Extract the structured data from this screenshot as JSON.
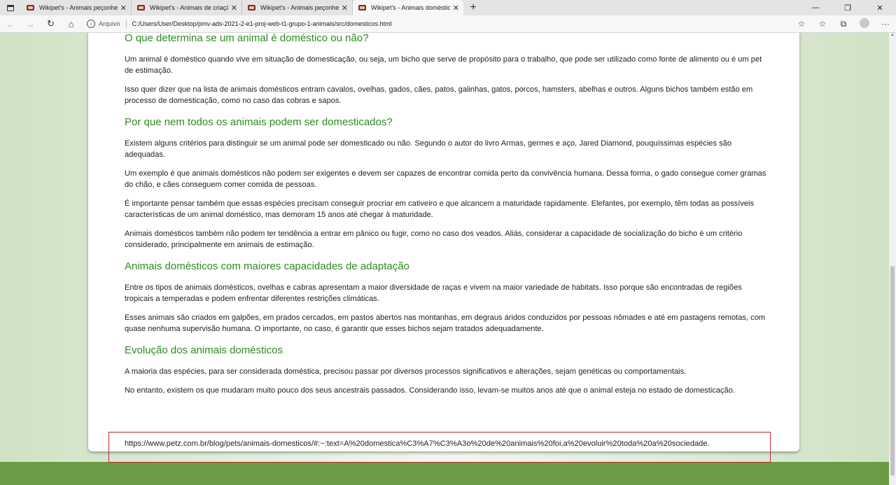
{
  "browser": {
    "tabs": [
      {
        "title": "Wikipet's - Animais peçonhentos",
        "close": "✕"
      },
      {
        "title": "Wikipet's - Animais de criação",
        "close": "✕"
      },
      {
        "title": "Wikipet's - Animais peçonhentos",
        "close": "✕"
      },
      {
        "title": "Wikipet's - Animais domésticos",
        "close": "✕"
      }
    ],
    "active_tab_index": 3,
    "new_tab": "+",
    "window_controls": {
      "minimize": "—",
      "restore": "❐",
      "close": "✕"
    },
    "nav": {
      "back": "←",
      "forward": "→",
      "refresh": "↻",
      "home": "⌂"
    },
    "address": {
      "info_icon": "i",
      "scheme_label": "Arquivo",
      "url": "C:/Users/User/Desktop/pmv-ads-2021-2-e1-proj-web-t1-grupo-1-animais/src/domesticos.html"
    },
    "toolbar_icons": {
      "favorite_add": "☆",
      "favorites": "☆",
      "collections": "⧉",
      "more": "···"
    }
  },
  "page": {
    "heading1": "O que determina se um animal é doméstico ou não?",
    "p1": "Um animal é doméstico quando vive em situação de domesticação, ou seja, um bicho que serve de propósito para o trabalho, que pode ser utilizado como fonte de alimento ou é um pet de estimação.",
    "p2": "Isso quer dizer que na lista de animais domésticos entram cavalos, ovelhas, gados, cães, patos, galinhas, gatos, porcos, hamsters, abelhas e outros. Alguns bichos também estão em processo de domesticação, como no caso das cobras e sapos.",
    "heading2": "Por que nem todos os animais podem ser domesticados?",
    "p3": "Existem alguns critérios para distinguir se um animal pode ser domesticado ou não. Segundo o autor do livro Armas, germes e aço, Jared Diamond, pouquíssimas espécies são adequadas.",
    "p4": "Um exemplo é que animais domésticos não podem ser exigentes e devem ser capazes de encontrar comida perto da convivência humana. Dessa forma, o gado consegue comer gramas do chão, e cães conseguem comer comida de pessoas.",
    "p5": "É importante pensar também que essas espécies precisam conseguir procriar em cativeiro e que alcancem a maturidade rapidamente. Elefantes, por exemplo, têm todas as possíveis características de um animal doméstico, mas demoram 15 anos até chegar à maturidade.",
    "p6": "Animais domésticos também não podem ter tendência a entrar em pânico ou fugir, como no caso dos veados. Aliás, considerar a capacidade de socialização do bicho é um critério considerado, principalmente em animais de estimação.",
    "heading3": "Animais domésticos com maiores capacidades de adaptação",
    "p7": "Entre os tipos de animais domésticos, ovelhas e cabras apresentam a maior diversidade de raças e vivem na maior variedade de habitats. Isso porque são encontradas de regiões tropicais a temperadas e podem enfrentar diferentes restrições climáticas.",
    "p8": "Esses animais são criados em galpões, em prados cercados, em pastos abertos nas montanhas, em degraus áridos conduzidos por pessoas nômades e até em pastagens remotas, com quase nenhuma supervisão humana. O importante, no caso, é garantir que esses bichos sejam tratados adequadamente.",
    "heading4": "Evolução dos animais domésticos",
    "p9": "A maioria das espécies, para ser considerada doméstica, precisou passar por diversos processos significativos e alterações, sejam genéticas ou comportamentais.",
    "p10": "No entanto, existem os que mudaram muito pouco dos seus ancestrais passados. Considerando isso, levam-se muitos anos até que o animal esteja no estado de domesticação.",
    "reference": "https://www.petz.com.br/blog/pets/animais-domesticos/#:~:text=A%20domestica%C3%A7%C3%A3o%20de%20animais%20foi,a%20evoluir%20toda%20a%20sociedade."
  }
}
